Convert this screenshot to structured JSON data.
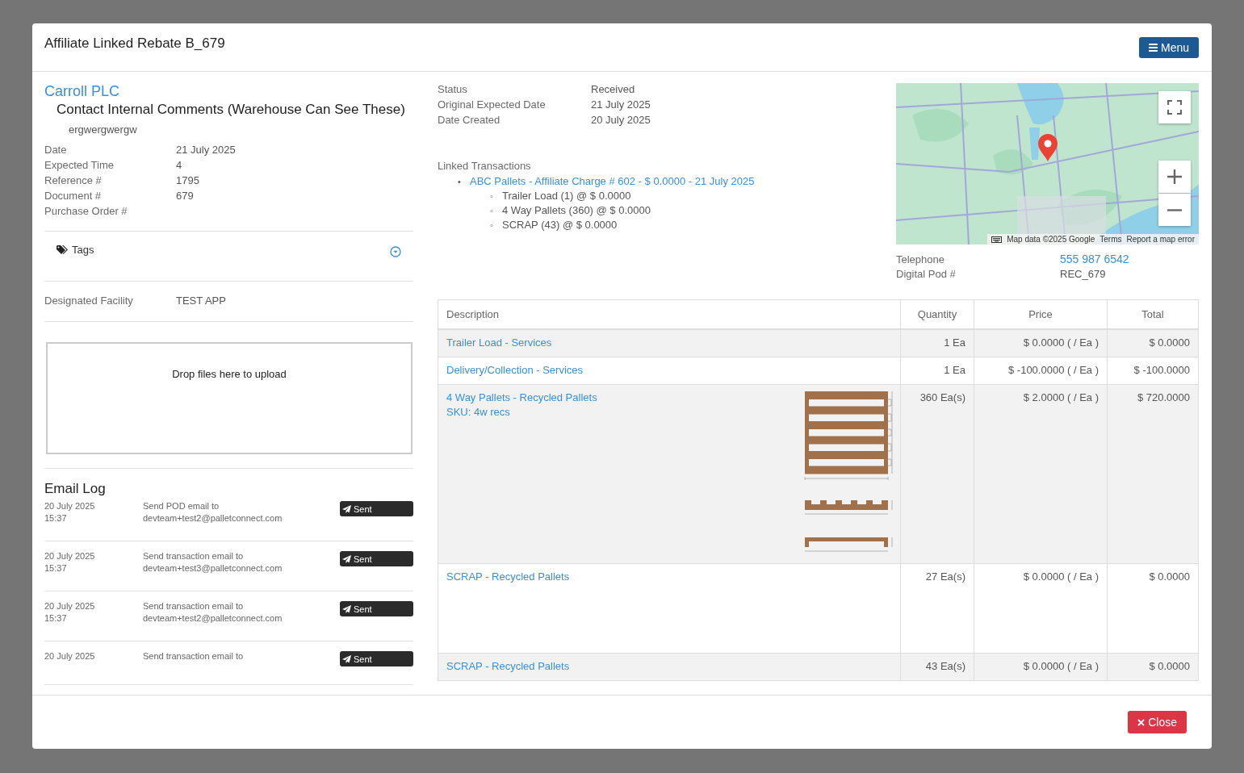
{
  "modal": {
    "title": "Affiliate Linked Rebate B_679",
    "menu_button": "Menu",
    "close_button": "Close"
  },
  "contact": {
    "name": "Carroll PLC",
    "comments_heading": "Contact Internal Comments (Warehouse Can See These)",
    "comments": "ergwergwergw"
  },
  "details": [
    {
      "label": "Date",
      "value": "21 July 2025"
    },
    {
      "label": "Expected Time",
      "value": "4"
    },
    {
      "label": "Reference #",
      "value": "1795"
    },
    {
      "label": "Document #",
      "value": "679"
    },
    {
      "label": "Purchase Order #"
    }
  ],
  "tags": {
    "label": "Tags"
  },
  "designated_facility": {
    "label": "Designated Facility",
    "value": "TEST APP"
  },
  "upload": {
    "prompt": "Drop files here to upload"
  },
  "email_log": {
    "title": "Email Log",
    "entries": [
      {
        "date": "20 July 2025",
        "time": "15:37",
        "message": "Send POD email to",
        "recipient": "devteam+test2@palletconnect.com",
        "status": "Sent"
      },
      {
        "date": "20 July 2025",
        "time": "15:37",
        "message": "Send transaction email to",
        "recipient": "devteam+test3@palletconnect.com",
        "status": "Sent"
      },
      {
        "date": "20 July 2025",
        "time": "15:37",
        "message": "Send transaction email to",
        "recipient": "devteam+test2@palletconnect.com",
        "status": "Sent"
      },
      {
        "date": "20 July 2025",
        "message": "Send transaction email to",
        "status": "Sent"
      }
    ]
  },
  "status_fields": [
    {
      "label": "Status",
      "value": "Received"
    },
    {
      "label": "Original Expected Date",
      "value": "21 July 2025"
    },
    {
      "label": "Date Created",
      "value": "20 July 2025"
    }
  ],
  "linked_transactions": {
    "label": "Linked Transactions",
    "items": [
      {
        "marker": "•",
        "text": "ABC Pallets - Affiliate Charge # 602 - $ 0.0000 - 21 July 2025",
        "children": [
          {
            "marker": "◦",
            "text": "Trailer Load (1) @ $ 0.0000"
          },
          {
            "marker": "◦",
            "text": "4 Way Pallets (360) @ $ 0.0000"
          },
          {
            "marker": "◦",
            "text": "SCRAP (43) @ $ 0.0000"
          }
        ]
      }
    ]
  },
  "map": {
    "attribution": "Map data ©2025 Google",
    "links": [
      "Terms",
      "Report a map error"
    ]
  },
  "contact_fields": [
    {
      "label": "Telephone",
      "value": "555 987 6542",
      "kind": "link"
    },
    {
      "label": "Digital Pod #",
      "value": "REC_679",
      "kind": "text"
    }
  ],
  "line_items": {
    "columns": [
      "Description",
      "Quantity",
      "Price",
      "Total"
    ],
    "rows": [
      {
        "kind": "plain",
        "description": "Trailer Load - Services",
        "quantity": "1 Ea",
        "price": "$ 0.0000 ( / Ea )",
        "total": "$ 0.0000"
      },
      {
        "kind": "plain",
        "description": "Delivery/Collection - Services",
        "quantity": "1 Ea",
        "price": "$ -100.0000 ( / Ea )",
        "total": "$ -100.0000"
      },
      {
        "kind": "drawing",
        "description": "4 Way Pallets - Recycled Pallets",
        "sku": "SKU: 4w recs",
        "quantity": "360 Ea(s)",
        "price": "$ 2.0000 ( / Ea )",
        "total": "$ 720.0000"
      },
      {
        "kind": "tall",
        "description": "SCRAP - Recycled Pallets",
        "quantity": "27 Ea(s)",
        "price": "$ 0.0000 ( / Ea )",
        "total": "$ 0.0000"
      },
      {
        "kind": "plain",
        "description": "SCRAP - Recycled Pallets",
        "quantity": "43 Ea(s)",
        "price": "$ 0.0000 ( / Ea )",
        "total": "$ 0.0000"
      }
    ]
  }
}
